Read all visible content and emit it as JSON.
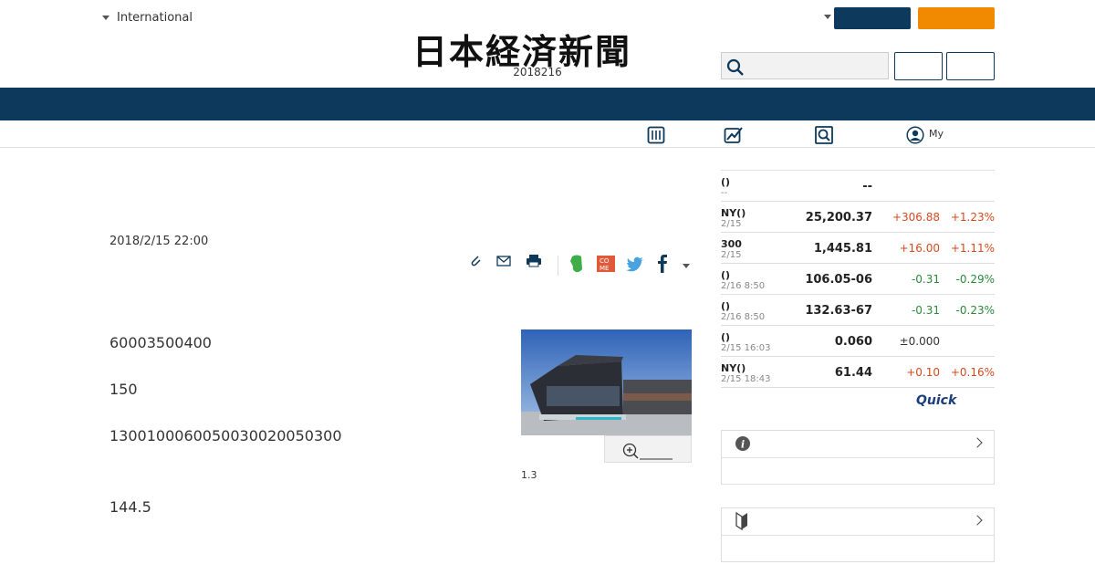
{
  "header": {
    "edition": "International",
    "logo": "日本経済新聞",
    "date": "2018216",
    "subnav_my": "My"
  },
  "article": {
    "published": "2018/2/15 22:00",
    "paragraphs": [
      "60003500400",
      "150",
      "130010006005003002005030​0",
      "144.5"
    ],
    "photo_caption": "1.3"
  },
  "markets": [
    {
      "name": "()",
      "sub": "--",
      "value": "--",
      "change": "",
      "pct": "",
      "dir": "flat"
    },
    {
      "name": "NY()",
      "sub": "2/15",
      "value": "25,200.37",
      "change": "+306.88",
      "pct": "+1.23%",
      "dir": "up"
    },
    {
      "name": "300",
      "sub": "2/15",
      "value": "1,445.81",
      "change": "+16.00",
      "pct": "+1.11%",
      "dir": "up"
    },
    {
      "name": "()",
      "sub": "2/16 8:50",
      "value": "106.05-06",
      "change": "-0.31",
      "pct": "-0.29%",
      "dir": "down"
    },
    {
      "name": "()",
      "sub": "2/16 8:50",
      "value": "132.63-67",
      "change": "-0.31",
      "pct": "-0.23%",
      "dir": "down"
    },
    {
      "name": "()",
      "sub": "2/15 16:03",
      "value": "0.060",
      "change": "±0.000",
      "pct": "",
      "dir": "flat"
    },
    {
      "name": "NY()",
      "sub": "2/15 18:43",
      "value": "61.44",
      "change": "+0.10",
      "pct": "+0.16%",
      "dir": "up"
    }
  ],
  "quick_logo": "Quick",
  "colors": {
    "navy": "#0d3a5c",
    "orange": "#f28a00",
    "up": "#d34a1f",
    "down": "#2a8a3a"
  }
}
